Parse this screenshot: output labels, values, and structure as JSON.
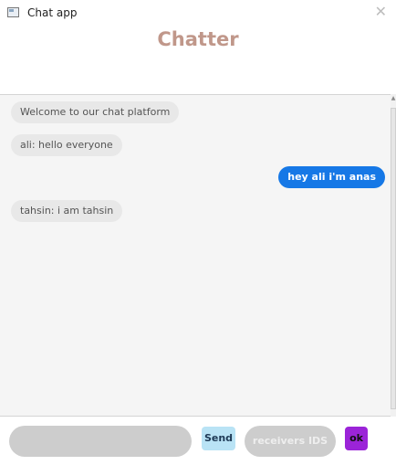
{
  "window": {
    "title": "Chat app",
    "close_glyph": "✕"
  },
  "header": {
    "title": "Chatter"
  },
  "messages": [
    {
      "text": "Welcome to our chat platform",
      "direction": "incoming"
    },
    {
      "text": "ali: hello everyone",
      "direction": "incoming"
    },
    {
      "text": "hey ali i'm anas",
      "direction": "outgoing"
    },
    {
      "text": "tahsin: i am tahsin",
      "direction": "incoming"
    }
  ],
  "composer": {
    "message_value": "",
    "send_label": "Send",
    "receivers_placeholder": "receivers IDS",
    "ok_label": "ok"
  },
  "colors": {
    "title": "#c0978a",
    "outgoing_bubble": "#1678e6",
    "incoming_bubble": "#e8e8e8",
    "send_button": "#b9e3f5",
    "ok_button": "#9b24d8"
  }
}
